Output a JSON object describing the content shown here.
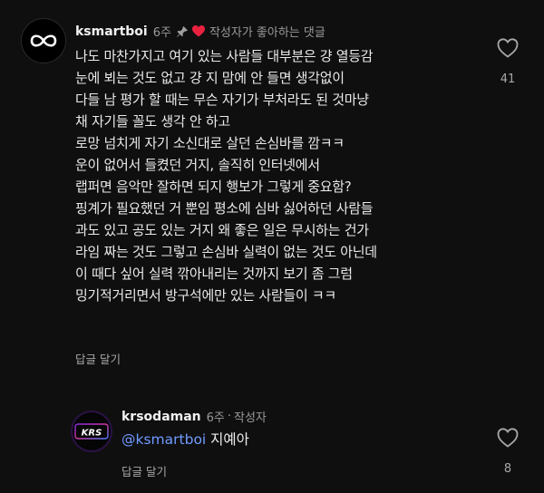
{
  "comment": {
    "username": "ksmartboi",
    "timestamp": "6주",
    "liked_by_creator_label": "작성자가 좋아하는 댓글",
    "lines": [
      "나도 마찬가지고 여기 있는 사람들 대부분은 걍 열등감",
      "눈에 뵈는 것도 없고 걍 지 맘에 안 들면 생각없이",
      "다들 남 평가 할 때는 무슨 자기가 부처라도 된 것마냥",
      "채 자기들 꼴도 생각 안 하고",
      "로망 넘치게 자기 소신대로 살던 손심바를 깜ㅋㅋ",
      "운이 없어서 들켰던 거지, 솔직히 인터넷에서",
      "랩퍼면 음악만 잘하면 되지 행보가 그렇게 중요함?",
      "핑계가 필요했던 거 뿐임 평소에 심바 싫어하던 사람들",
      "과도 있고 공도 있는 거지 왜 좋은 일은 무시하는 건가",
      "라임 짜는 것도 그렇고 손심바 실력이 없는 것도 아닌데",
      "이 때다 싶어 실력 깎아내리는 것까지 보기 좀 그럼",
      "밍기적거리면서 방구석에만 있는 사람들이 ㅋㅋ"
    ],
    "reply_label": "답글 달기",
    "like_count": "41"
  },
  "reply": {
    "username": "krsodaman",
    "timestamp": "6주",
    "separator": "·",
    "author_tag": "작성자",
    "mention": "@ksmartboi",
    "text": " 지예아",
    "reply_label": "답글 달기",
    "like_count": "8",
    "avatar_text": "KRS"
  },
  "colors": {
    "background": "#0f0f10",
    "mention": "#6f9bff",
    "heart": "#e8213f"
  }
}
